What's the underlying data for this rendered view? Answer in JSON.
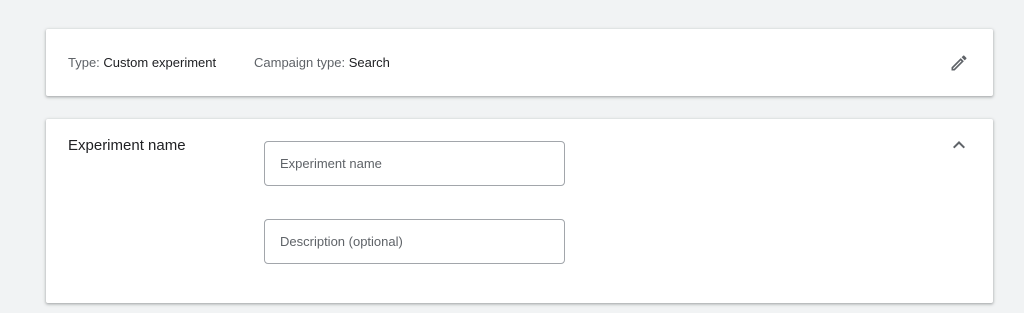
{
  "summary": {
    "type_label": "Type:",
    "type_value": "Custom experiment",
    "campaign_label": "Campaign type:",
    "campaign_value": "Search",
    "edit_icon": "pencil-icon"
  },
  "experiment": {
    "section_title": "Experiment name",
    "collapse_icon": "chevron-up-icon",
    "name_field": {
      "placeholder": "Experiment name",
      "value": ""
    },
    "description_field": {
      "placeholder": "Description (optional)",
      "value": ""
    }
  },
  "colors": {
    "background": "#f1f3f4",
    "card": "#ffffff",
    "icon": "#5f6368",
    "field_border": "#a2a6ab"
  }
}
